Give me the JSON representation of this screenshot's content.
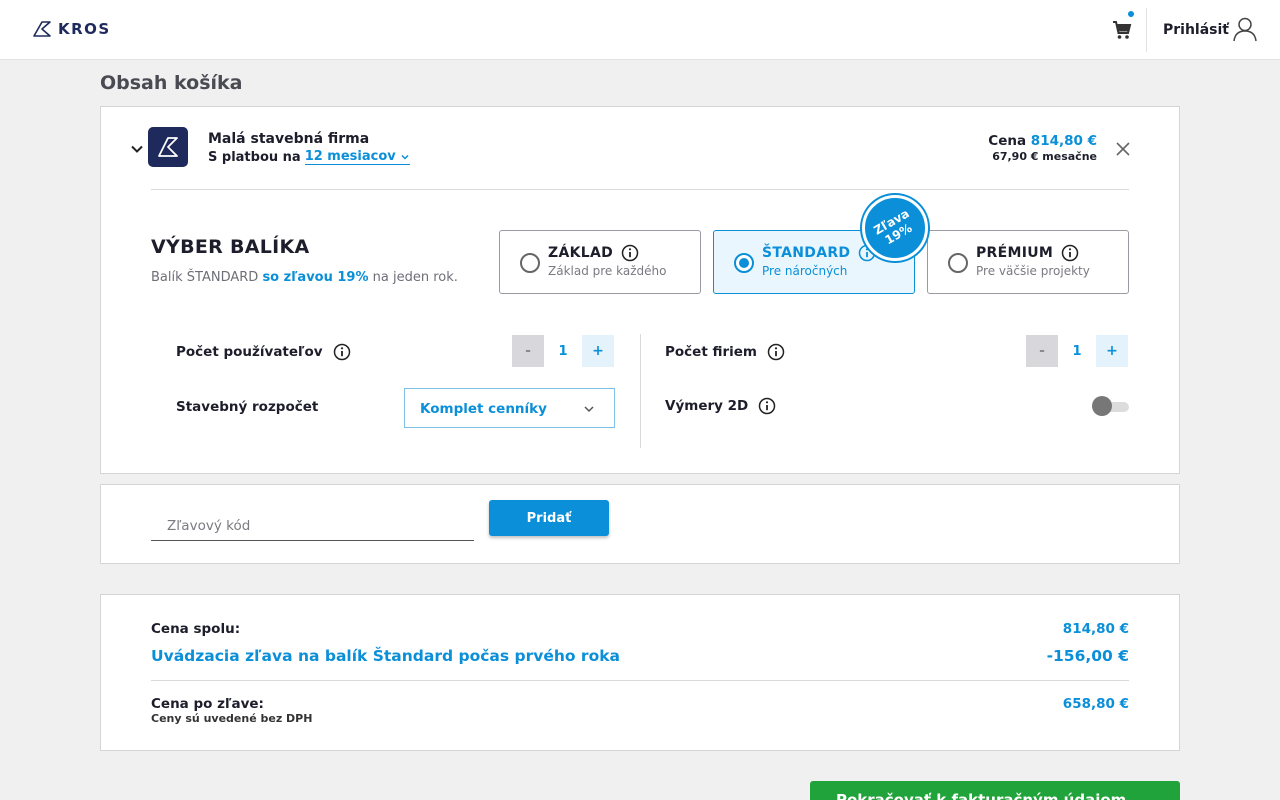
{
  "header": {
    "logo_text": "KROS",
    "login_label": "Prihlásiť",
    "cart_icon": "cart-icon",
    "user_icon": "user-icon"
  },
  "page": {
    "title": "Obsah košíka"
  },
  "product": {
    "name": "Malá stavebná firma",
    "plan_prefix": "S platbou na",
    "plan_period": "12 mesiacov",
    "price_label": "Cena",
    "price_value": "814,80 €",
    "price_monthly": "67,90 € mesačne"
  },
  "package_selection": {
    "title": "VÝBER BALÍKA",
    "subtitle_pre": "Balík ŠTANDARD",
    "subtitle_highlight": "so zľavou 19%",
    "subtitle_post": "na jeden rok.",
    "discount_badge_line1": "Zľava",
    "discount_badge_line2": "19%",
    "packages": [
      {
        "name": "ZÁKLAD",
        "desc": "Základ pre každého",
        "selected": false
      },
      {
        "name": "ŠTANDARD",
        "desc": "Pre náročných",
        "selected": true
      },
      {
        "name": "PRÉMIUM",
        "desc": "Pre väčšie projekty",
        "selected": false
      }
    ]
  },
  "options": {
    "users_label": "Počet používateľov",
    "users_value": "1",
    "firms_label": "Počet firiem",
    "firms_value": "1",
    "minus_label": "-",
    "plus_label": "+",
    "budget_label": "Stavebný rozpočet",
    "budget_value": "Komplet cenníky",
    "measure_label": "Výmery 2D",
    "measure_enabled": false
  },
  "discount": {
    "placeholder": "Zľavový kód",
    "add_label": "Pridať"
  },
  "summary": {
    "total_label": "Cena spolu:",
    "total_value": "814,80 €",
    "promo_label": "Uvádzacia zľava na balík Štandard počas prvého roka",
    "promo_value": "-156,00 €",
    "after_label": "Cena po zľave:",
    "after_value": "658,80 €",
    "note": "Ceny sú uvedené bez DPH"
  },
  "cta": {
    "label": "Pokračovať k fakturačným údajom"
  },
  "colors": {
    "accent": "#0a8fd8",
    "brand_navy": "#1f2a5c",
    "cta_green": "#1fa33a"
  }
}
